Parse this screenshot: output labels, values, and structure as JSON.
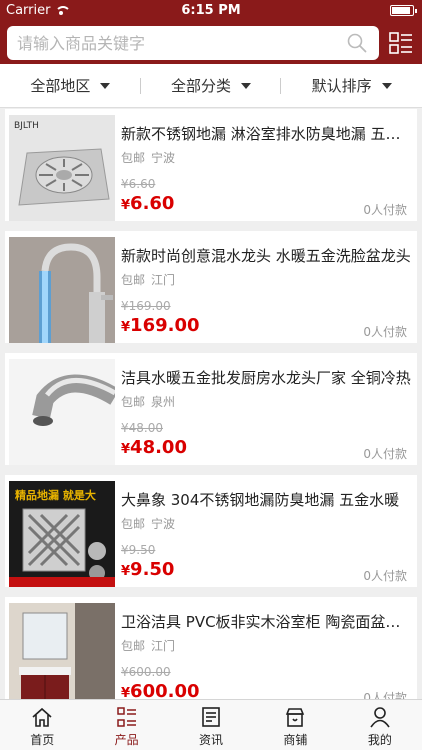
{
  "status": {
    "carrier": "Carrier",
    "time": "6:15 PM"
  },
  "search": {
    "placeholder": "请输入商品关键字"
  },
  "filters": [
    {
      "label": "全部地区"
    },
    {
      "label": "全部分类"
    },
    {
      "label": "默认排序"
    }
  ],
  "products": [
    {
      "title": "新款不锈钢地漏 淋浴室排水防臭地漏 五金配件",
      "shipping": "包邮",
      "city": "宁波",
      "old_price": "¥6.60",
      "price_symbol": "¥",
      "price": "6.60",
      "sold": "0人付款",
      "thumb_text": "BJLTH"
    },
    {
      "title": "新款时尚创意混水龙头 水暖五金洗脸盆龙头",
      "shipping": "包邮",
      "city": "江门",
      "old_price": "¥169.00",
      "price_symbol": "¥",
      "price": "169.00",
      "sold": "0人付款",
      "thumb_text": ""
    },
    {
      "title": "洁具水暖五金批发厨房水龙头厂家 全铜冷热",
      "shipping": "包邮",
      "city": "泉州",
      "old_price": "¥48.00",
      "price_symbol": "¥",
      "price": "48.00",
      "sold": "0人付款",
      "thumb_text": ""
    },
    {
      "title": "大鼻象 304不锈钢地漏防臭地漏 五金水暖",
      "shipping": "包邮",
      "city": "宁波",
      "old_price": "¥9.50",
      "price_symbol": "¥",
      "price": "9.50",
      "sold": "0人付款",
      "thumb_text": "精品地漏 就是大"
    },
    {
      "title": "卫浴洁具 PVC板非实木浴室柜 陶瓷面盆组合",
      "shipping": "包邮",
      "city": "江门",
      "old_price": "¥600.00",
      "price_symbol": "¥",
      "price": "600.00",
      "sold": "0人付款",
      "thumb_text": ""
    }
  ],
  "tabs": [
    {
      "label": "首页",
      "icon": "home-icon"
    },
    {
      "label": "产品",
      "icon": "product-list-icon"
    },
    {
      "label": "资讯",
      "icon": "news-icon"
    },
    {
      "label": "商铺",
      "icon": "shop-icon"
    },
    {
      "label": "我的",
      "icon": "profile-icon"
    }
  ],
  "colors": {
    "brand": "#8a1a1a",
    "price": "#d90000"
  }
}
